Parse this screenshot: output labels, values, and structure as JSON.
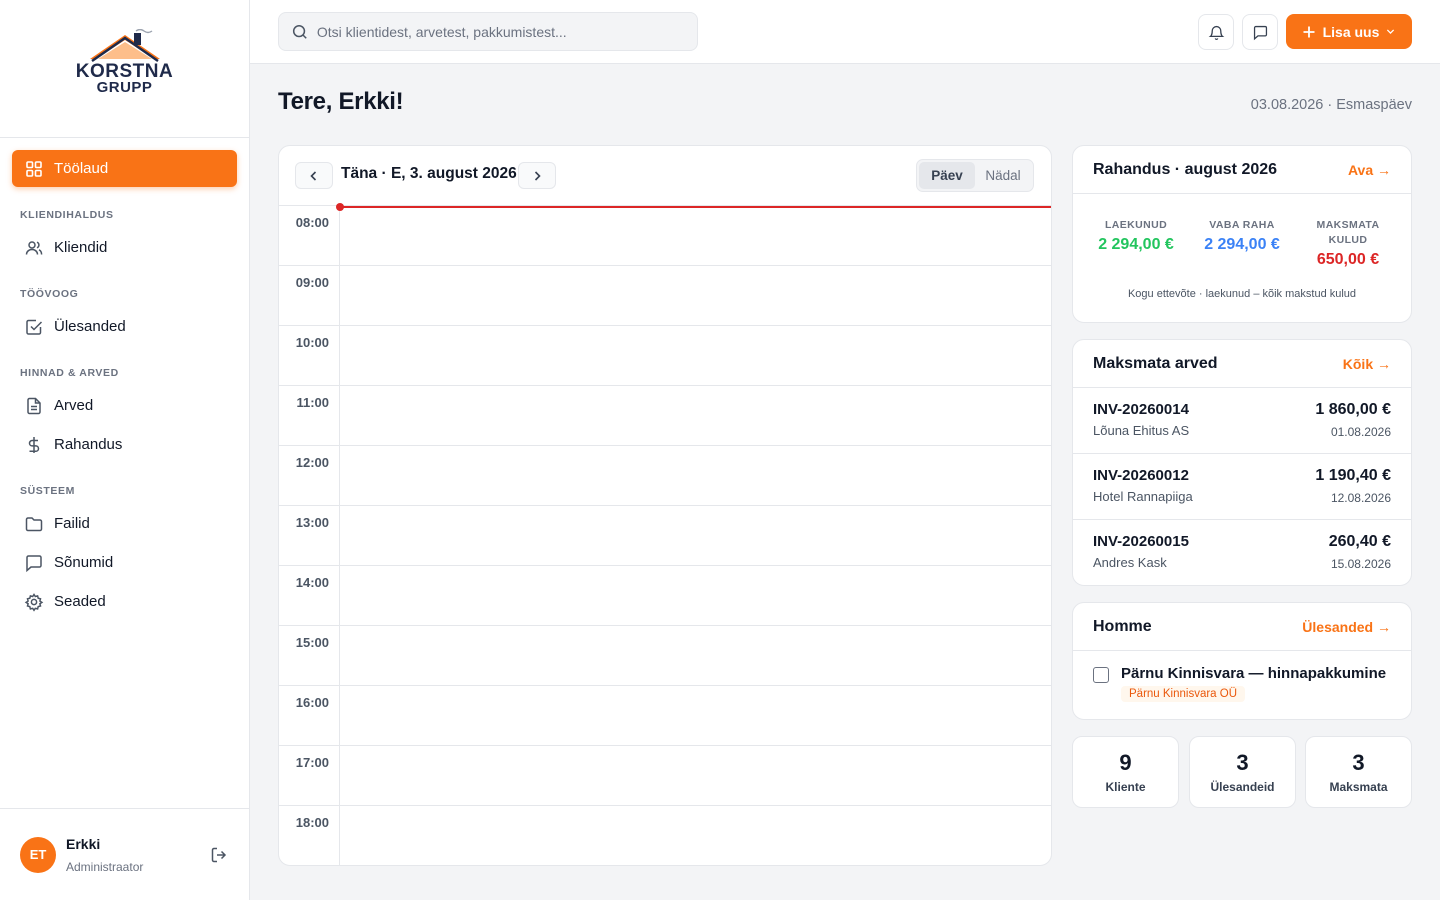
{
  "brand": {
    "name_line1": "KORSTNA",
    "name_line2": "GRUPP",
    "color": "#f97316",
    "dark": "#1f2a4a"
  },
  "sidebar": {
    "active": {
      "label": "Töölaud",
      "icon": "grid-icon"
    },
    "sections": [
      {
        "title": "KLIENDIHALDUS",
        "items": [
          {
            "label": "Kliendid",
            "icon": "users-icon"
          }
        ]
      },
      {
        "title": "TÖÖVOOG",
        "items": [
          {
            "label": "Ülesanded",
            "icon": "checkbox-icon"
          }
        ]
      },
      {
        "title": "HINNAD & ARVED",
        "items": [
          {
            "label": "Arved",
            "icon": "document-icon"
          },
          {
            "label": "Rahandus",
            "icon": "dollar-icon"
          }
        ]
      },
      {
        "title": "SÜSTEEM",
        "items": [
          {
            "label": "Failid",
            "icon": "folder-icon"
          },
          {
            "label": "Sõnumid",
            "icon": "message-icon"
          },
          {
            "label": "Seaded",
            "icon": "gear-icon"
          }
        ]
      }
    ],
    "user": {
      "initials": "ET",
      "name": "Erkki",
      "role": "Administraator"
    }
  },
  "topbar": {
    "search_placeholder": "Otsi klientidest, arvetest, pakkumistest...",
    "add_label": "Lisa uus"
  },
  "header": {
    "greeting": "Tere, Erkki!",
    "date": "03.08.2026 · Esmaspäev"
  },
  "calendar": {
    "title": "Täna · E, 3. august 2026",
    "views": [
      "Päev",
      "Nädal"
    ],
    "active_view": "Päev",
    "hours": [
      "08:00",
      "09:00",
      "10:00",
      "11:00",
      "12:00",
      "13:00",
      "14:00",
      "15:00",
      "16:00",
      "17:00",
      "18:00"
    ]
  },
  "finance": {
    "title": "Rahandus · august 2026",
    "link": "Ava →",
    "received_label": "LAEKUNUD",
    "received": "2 294,00 €",
    "received_color": "#22c55e",
    "free_label": "VABA RAHA",
    "free": "2 294,00 €",
    "free_color": "#3b82f6",
    "unpaid_label_1": "MAKSMATA",
    "unpaid_label_2": "KULUD",
    "unpaid": "650,00 €",
    "unpaid_color": "#dc2626",
    "note": "Kogu ettevõte · laekunud – kõik makstud kulud"
  },
  "unpaid_invoices": {
    "title": "Maksmata arved",
    "link": "Kõik →",
    "items": [
      {
        "number": "INV-20260014",
        "client": "Lõuna Ehitus AS",
        "amount": "1 860,00 €",
        "date": "01.08.2026"
      },
      {
        "number": "INV-20260012",
        "client": "Hotel Rannapiiga",
        "amount": "1 190,40 €",
        "date": "12.08.2026"
      },
      {
        "number": "INV-20260015",
        "client": "Andres Kask",
        "amount": "260,40 €",
        "date": "15.08.2026"
      }
    ]
  },
  "tomorrow": {
    "title": "Homme",
    "link": "Ülesanded →",
    "task": {
      "title": "Pärnu Kinnisvara — hinnapakkumine",
      "tag": "Pärnu Kinnisvara OÜ"
    }
  },
  "stats": [
    {
      "value": "9",
      "label": "Kliente"
    },
    {
      "value": "3",
      "label": "Ülesandeid"
    },
    {
      "value": "3",
      "label": "Maksmata"
    }
  ]
}
